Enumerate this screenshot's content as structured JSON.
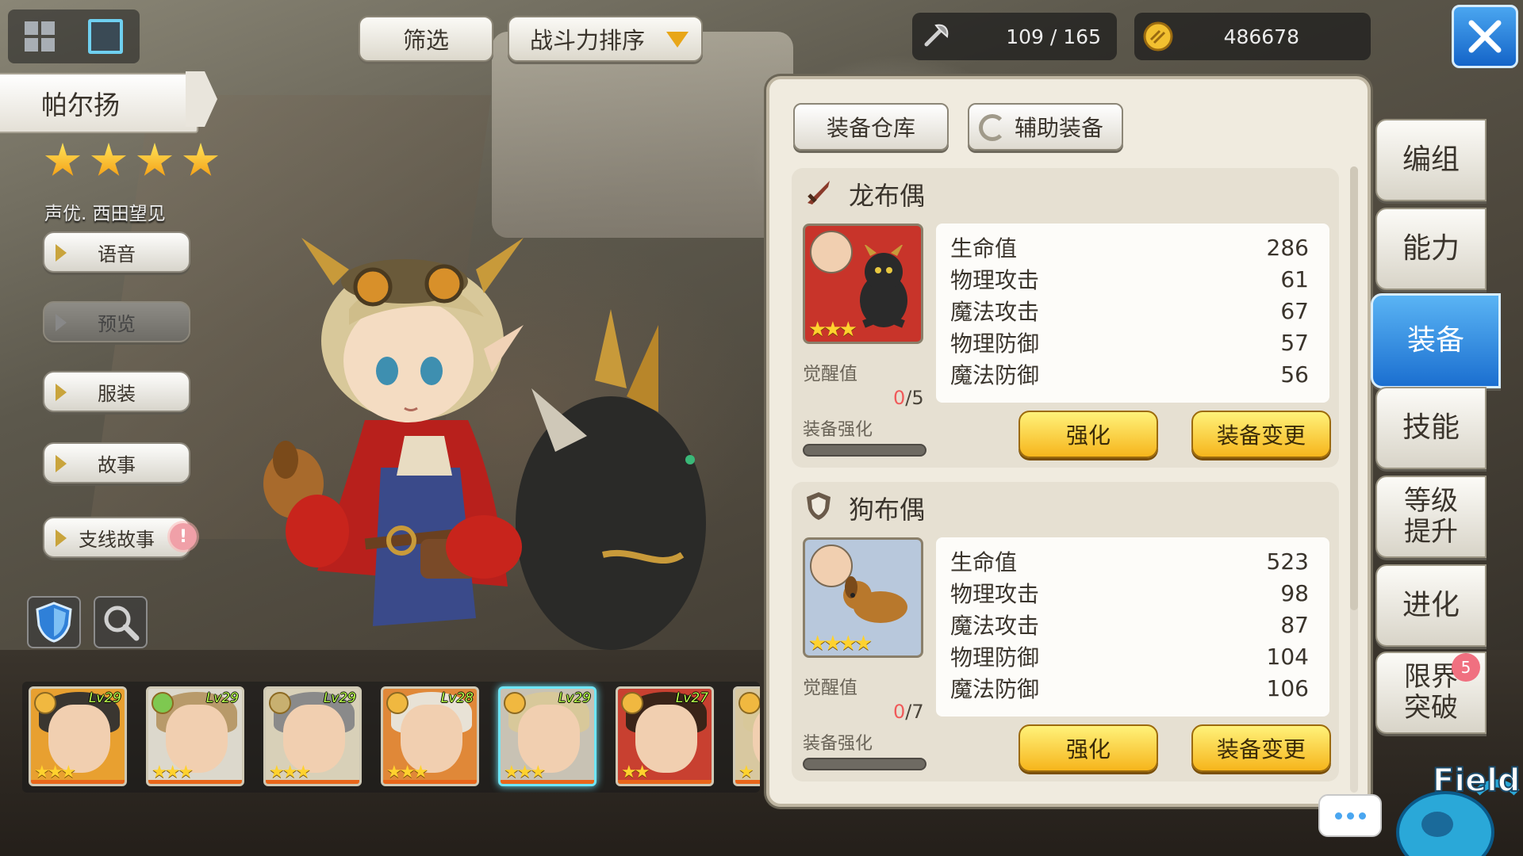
{
  "top_bar": {
    "filter_label": "筛选",
    "sort_label": "战斗力排序",
    "stamina_current": "109",
    "stamina_sep": "/",
    "stamina_max": "165",
    "gold": "486678"
  },
  "character": {
    "name": "帕尔扬",
    "stars": 4,
    "voice_actor": "声优. 西田望见"
  },
  "side_menu": [
    {
      "label": "语音",
      "enabled": true
    },
    {
      "label": "预览",
      "enabled": false
    },
    {
      "label": "服装",
      "enabled": true
    },
    {
      "label": "故事",
      "enabled": true
    },
    {
      "label": "支线故事",
      "enabled": true,
      "alert": "!"
    }
  ],
  "roster": [
    {
      "level": "Lv29",
      "stars": "★★★",
      "hair": "#3a3630",
      "bg": "#e8a030",
      "elem": "#f0b840"
    },
    {
      "level": "Lv29",
      "stars": "★★★",
      "hair": "#b89a6a",
      "bg": "#dcd8cc",
      "elem": "#7ec850"
    },
    {
      "level": "Lv29",
      "stars": "★★★",
      "hair": "#8a8a8a",
      "bg": "#d8d0b8",
      "elem": "#c8b070"
    },
    {
      "level": "Lv28",
      "stars": "★★★",
      "hair": "#e8e2d6",
      "bg": "#e08838",
      "elem": "#f0b840"
    },
    {
      "level": "Lv29",
      "stars": "★★★",
      "hair": "#d8c89a",
      "bg": "#c8c2b4",
      "elem": "#f0b840",
      "selected": true
    },
    {
      "level": "Lv27",
      "stars": "★★",
      "hair": "#3a2418",
      "bg": "#c84030",
      "elem": "#f0b840"
    },
    {
      "level": "",
      "stars": "★",
      "hair": "#d8c89a",
      "bg": "#d8c8a0",
      "elem": "#f0b840"
    }
  ],
  "equipment_panel": {
    "tab_warehouse": "装备仓库",
    "tab_aux": "辅助装备",
    "items": [
      {
        "type_icon": "sword-icon",
        "name": "龙布偶",
        "stars": "★★★",
        "thumb_bg": "#c8342a",
        "awaken_label": "觉醒值",
        "awaken_current": "0",
        "awaken_sep": "/",
        "awaken_max": "5",
        "enhance_label": "装备强化",
        "stats": [
          {
            "name": "生命值",
            "value": "286"
          },
          {
            "name": "物理攻击",
            "value": "61"
          },
          {
            "name": "魔法攻击",
            "value": "67"
          },
          {
            "name": "物理防御",
            "value": "57"
          },
          {
            "name": "魔法防御",
            "value": "56"
          }
        ],
        "enhance_btn": "强化",
        "change_btn": "装备变更"
      },
      {
        "type_icon": "shield-icon",
        "name": "狗布偶",
        "stars": "★★★★",
        "thumb_bg": "#b8c8dc",
        "awaken_label": "觉醒值",
        "awaken_current": "0",
        "awaken_sep": "/",
        "awaken_max": "7",
        "enhance_label": "装备强化",
        "stats": [
          {
            "name": "生命值",
            "value": "523"
          },
          {
            "name": "物理攻击",
            "value": "98"
          },
          {
            "name": "魔法攻击",
            "value": "87"
          },
          {
            "name": "物理防御",
            "value": "104"
          },
          {
            "name": "魔法防御",
            "value": "106"
          }
        ],
        "enhance_btn": "强化",
        "change_btn": "装备变更"
      }
    ]
  },
  "right_tabs": [
    {
      "label": "编组"
    },
    {
      "label": "能力"
    },
    {
      "label": "装备",
      "active": true
    },
    {
      "label": "技能"
    },
    {
      "label": "等级\n提升"
    },
    {
      "label": "进化"
    },
    {
      "label": "限界\n突破",
      "badge": "5"
    }
  ],
  "field_label": "Field",
  "colors": {
    "accent_blue": "#1b6fd0",
    "button_yellow": "#f6b51c",
    "star_gold": "#ffd22e",
    "awaken_red": "#f05a5a",
    "level_green": "#b9ff4a"
  }
}
